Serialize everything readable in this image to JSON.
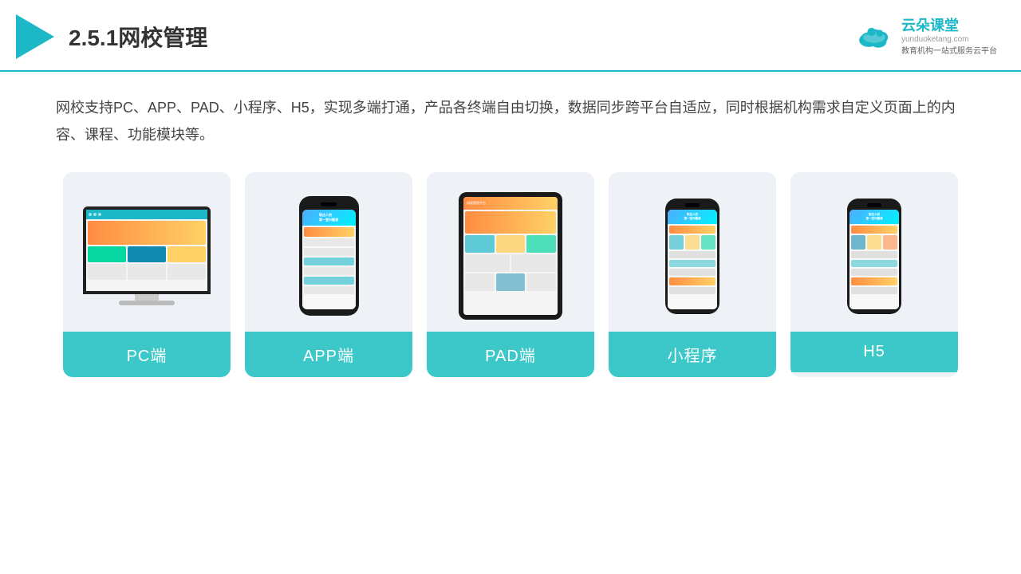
{
  "header": {
    "title": "2.5.1网校管理",
    "brand": {
      "name": "云朵课堂",
      "url": "yunduoketang.com",
      "tagline": "教育机构一站式服务云平台"
    }
  },
  "content": {
    "description": "网校支持PC、APP、PAD、小程序、H5，实现多端打通，产品各终端自由切换，数据同步跨平台自适应，同时根据机构需求自定义页面上的内容、课程、功能模块等。"
  },
  "cards": [
    {
      "id": "pc",
      "label": "PC端"
    },
    {
      "id": "app",
      "label": "APP端"
    },
    {
      "id": "pad",
      "label": "PAD端"
    },
    {
      "id": "miniapp",
      "label": "小程序"
    },
    {
      "id": "h5",
      "label": "H5"
    }
  ],
  "colors": {
    "accent": "#1db8c8",
    "card_bg": "#eef2f7",
    "label_bg": "#3cc8c8",
    "label_text": "#ffffff"
  }
}
